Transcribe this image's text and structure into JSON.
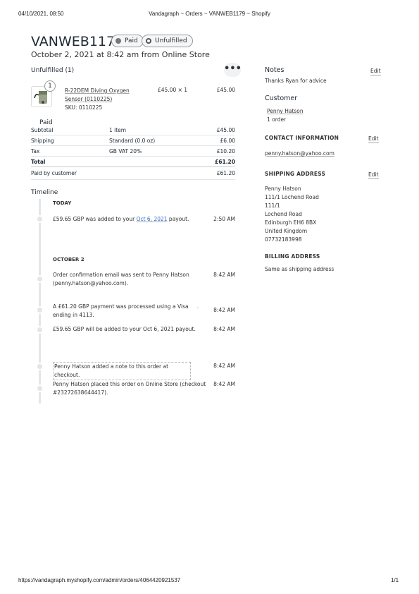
{
  "browser_header": {
    "datetime": "04/10/2021, 08:50",
    "title": "Vandagraph ~ Orders ~ VANWEB1179 ~ Shopify"
  },
  "order": {
    "id": "VANWEB1179",
    "badge_paid": "Paid",
    "badge_unfulfilled": "Unfulfilled",
    "subtitle": "October 2, 2021 at 8:42 am from Online Store"
  },
  "unfulfilled": {
    "title": "Unfulfilled (1)",
    "more_icon": "ellipsis-icon",
    "item": {
      "qty_badge": "1",
      "name_line1": "R-22DEM Diving Oxygen",
      "name_line2": "Sensor (0110225)",
      "sku": "SKU: 0110225",
      "unit_price": "£45.00 × 1",
      "total": "£45.00"
    }
  },
  "payment": {
    "title": "Paid",
    "rows": [
      {
        "label": "Subtotal",
        "detail": "1 item",
        "amount": "£45.00"
      },
      {
        "label": "Shipping",
        "detail": "Standard (0.0 oz)",
        "amount": "£6.00"
      },
      {
        "label": "Tax",
        "detail": "GB VAT 20%",
        "amount": "£10.20"
      },
      {
        "label": "Total",
        "detail": "",
        "amount": "£61.20"
      },
      {
        "label": "Paid by customer",
        "detail": "",
        "amount": "£61.20"
      }
    ]
  },
  "timeline": {
    "title": "Timeline",
    "today_label": "TODAY",
    "event1_pre": "£59.65 GBP was added to your ",
    "event1_link": "Oct 6, 2021",
    "event1_post": " payout.",
    "event1_time": "2:50 AM",
    "oct_label": "OCTOBER 2",
    "events": [
      {
        "text": "Order confirmation email was sent to Penny Hatson (penny.hatson@yahoo.com).",
        "time": "8:42 AM"
      },
      {
        "text": "A £61.20 GBP payment was processed using a Visa ending in 4113.",
        "time": "8:42 AM"
      },
      {
        "text": "£59.65 GBP will be added to your Oct 6, 2021 payout.",
        "time": "8:42 AM"
      },
      {
        "text": "Penny Hatson added a note to this order at checkout.",
        "time": "8:42 AM"
      },
      {
        "text": "Penny Hatson placed this order on Online Store (checkout #23272638644417).",
        "time": "8:42 AM"
      }
    ]
  },
  "notes": {
    "title": "Notes",
    "edit": "Edit",
    "text": "Thanks Ryan for advice"
  },
  "customer": {
    "title": "Customer",
    "name": "Penny Hatson",
    "orders": "1 order"
  },
  "contact": {
    "title": "CONTACT INFORMATION",
    "edit": "Edit",
    "email": "penny.hatson@yahoo.com"
  },
  "shipping": {
    "title": "SHIPPING ADDRESS",
    "edit": "Edit",
    "lines": [
      "Penny Hatson",
      "111/1 Lochend Road",
      "111/1",
      "Lochend Road",
      "Edinburgh EH6 8BX",
      "United Kingdom",
      "07732183998"
    ]
  },
  "billing": {
    "title": "BILLING ADDRESS",
    "text": "Same as shipping address"
  },
  "footer": {
    "url": "https://vandagraph.myshopify.com/admin/orders/4064420921537",
    "page": "1/1"
  }
}
